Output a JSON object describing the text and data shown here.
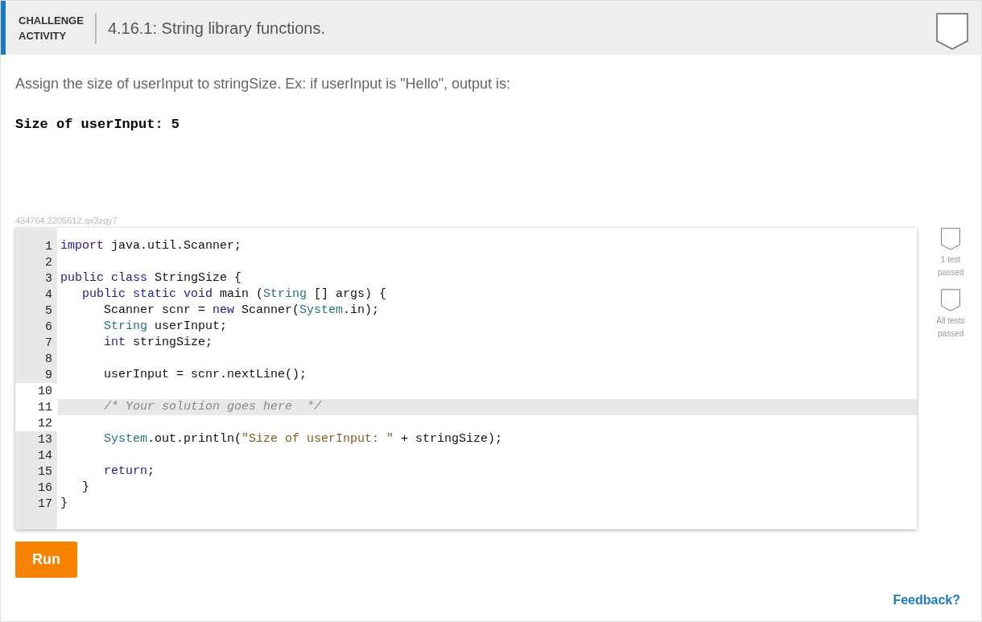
{
  "header": {
    "label_line1": "CHALLENGE",
    "label_line2": "ACTIVITY",
    "title": "4.16.1: String library functions."
  },
  "prompt": "Assign the size of userInput to stringSize. Ex: if userInput is \"Hello\", output is:",
  "example_output": "Size of userInput: 5",
  "activity_id": "434764.2205612.qx3zqy7",
  "code_lines": [
    {
      "number": "1",
      "editable": false,
      "selected": false,
      "tokens": [
        {
          "kind": "keyword",
          "text": "import"
        },
        {
          "kind": "plain",
          "text": " java.util.Scanner;"
        }
      ]
    },
    {
      "number": "2",
      "editable": false,
      "selected": false
    },
    {
      "number": "3",
      "editable": false,
      "selected": false,
      "tokens": [
        {
          "kind": "keyword",
          "text": "public class"
        },
        {
          "kind": "plain",
          "text": " StringSize {"
        }
      ]
    },
    {
      "number": "4",
      "editable": false,
      "selected": false,
      "tokens": [
        {
          "kind": "keyword",
          "text": "   public static void"
        },
        {
          "kind": "plain",
          "text": " main ("
        },
        {
          "kind": "type",
          "text": "String"
        },
        {
          "kind": "plain",
          "text": " [] args) {"
        }
      ]
    },
    {
      "number": "5",
      "editable": false,
      "selected": false,
      "tokens": [
        {
          "kind": "plain",
          "text": "      Scanner scnr = "
        },
        {
          "kind": "keyword",
          "text": "new"
        },
        {
          "kind": "plain",
          "text": " Scanner("
        },
        {
          "kind": "type",
          "text": "System"
        },
        {
          "kind": "plain",
          "text": ".in);"
        }
      ]
    },
    {
      "number": "6",
      "editable": false,
      "selected": false,
      "tokens": [
        {
          "kind": "type",
          "text": "      String"
        },
        {
          "kind": "plain",
          "text": " userInput;"
        }
      ]
    },
    {
      "number": "7",
      "editable": false,
      "selected": false,
      "tokens": [
        {
          "kind": "keyword",
          "text": "      int"
        },
        {
          "kind": "plain",
          "text": " stringSize;"
        }
      ]
    },
    {
      "number": "8",
      "editable": false,
      "selected": false
    },
    {
      "number": "9",
      "editable": false,
      "selected": false,
      "tokens": [
        {
          "kind": "plain",
          "text": "      userInput = scnr.nextLine();"
        }
      ]
    },
    {
      "number": "10",
      "editable": true,
      "selected": false
    },
    {
      "number": "11",
      "editable": true,
      "selected": true,
      "tokens": [
        {
          "kind": "comment",
          "text": "      /* Your solution goes here  */"
        }
      ]
    },
    {
      "number": "12",
      "editable": true,
      "selected": false
    },
    {
      "number": "13",
      "editable": false,
      "selected": false,
      "tokens": [
        {
          "kind": "type",
          "text": "      System"
        },
        {
          "kind": "plain",
          "text": ".out.println("
        },
        {
          "kind": "string",
          "text": "\"Size of userInput: \""
        },
        {
          "kind": "plain",
          "text": " + stringSize);"
        }
      ]
    },
    {
      "number": "14",
      "editable": false,
      "selected": false
    },
    {
      "number": "15",
      "editable": false,
      "selected": false,
      "tokens": [
        {
          "kind": "keyword",
          "text": "      return"
        },
        {
          "kind": "plain",
          "text": ";"
        }
      ]
    },
    {
      "number": "16",
      "editable": false,
      "selected": false,
      "tokens": [
        {
          "kind": "plain",
          "text": "   }"
        }
      ]
    },
    {
      "number": "17",
      "editable": false,
      "selected": false,
      "tokens": [
        {
          "kind": "plain",
          "text": "}"
        }
      ]
    }
  ],
  "test_badges": [
    {
      "label_line1": "1 test",
      "label_line2": "passed"
    },
    {
      "label_line1": "All tests",
      "label_line2": "passed"
    }
  ],
  "run_button": "Run",
  "feedback_link": "Feedback?"
}
